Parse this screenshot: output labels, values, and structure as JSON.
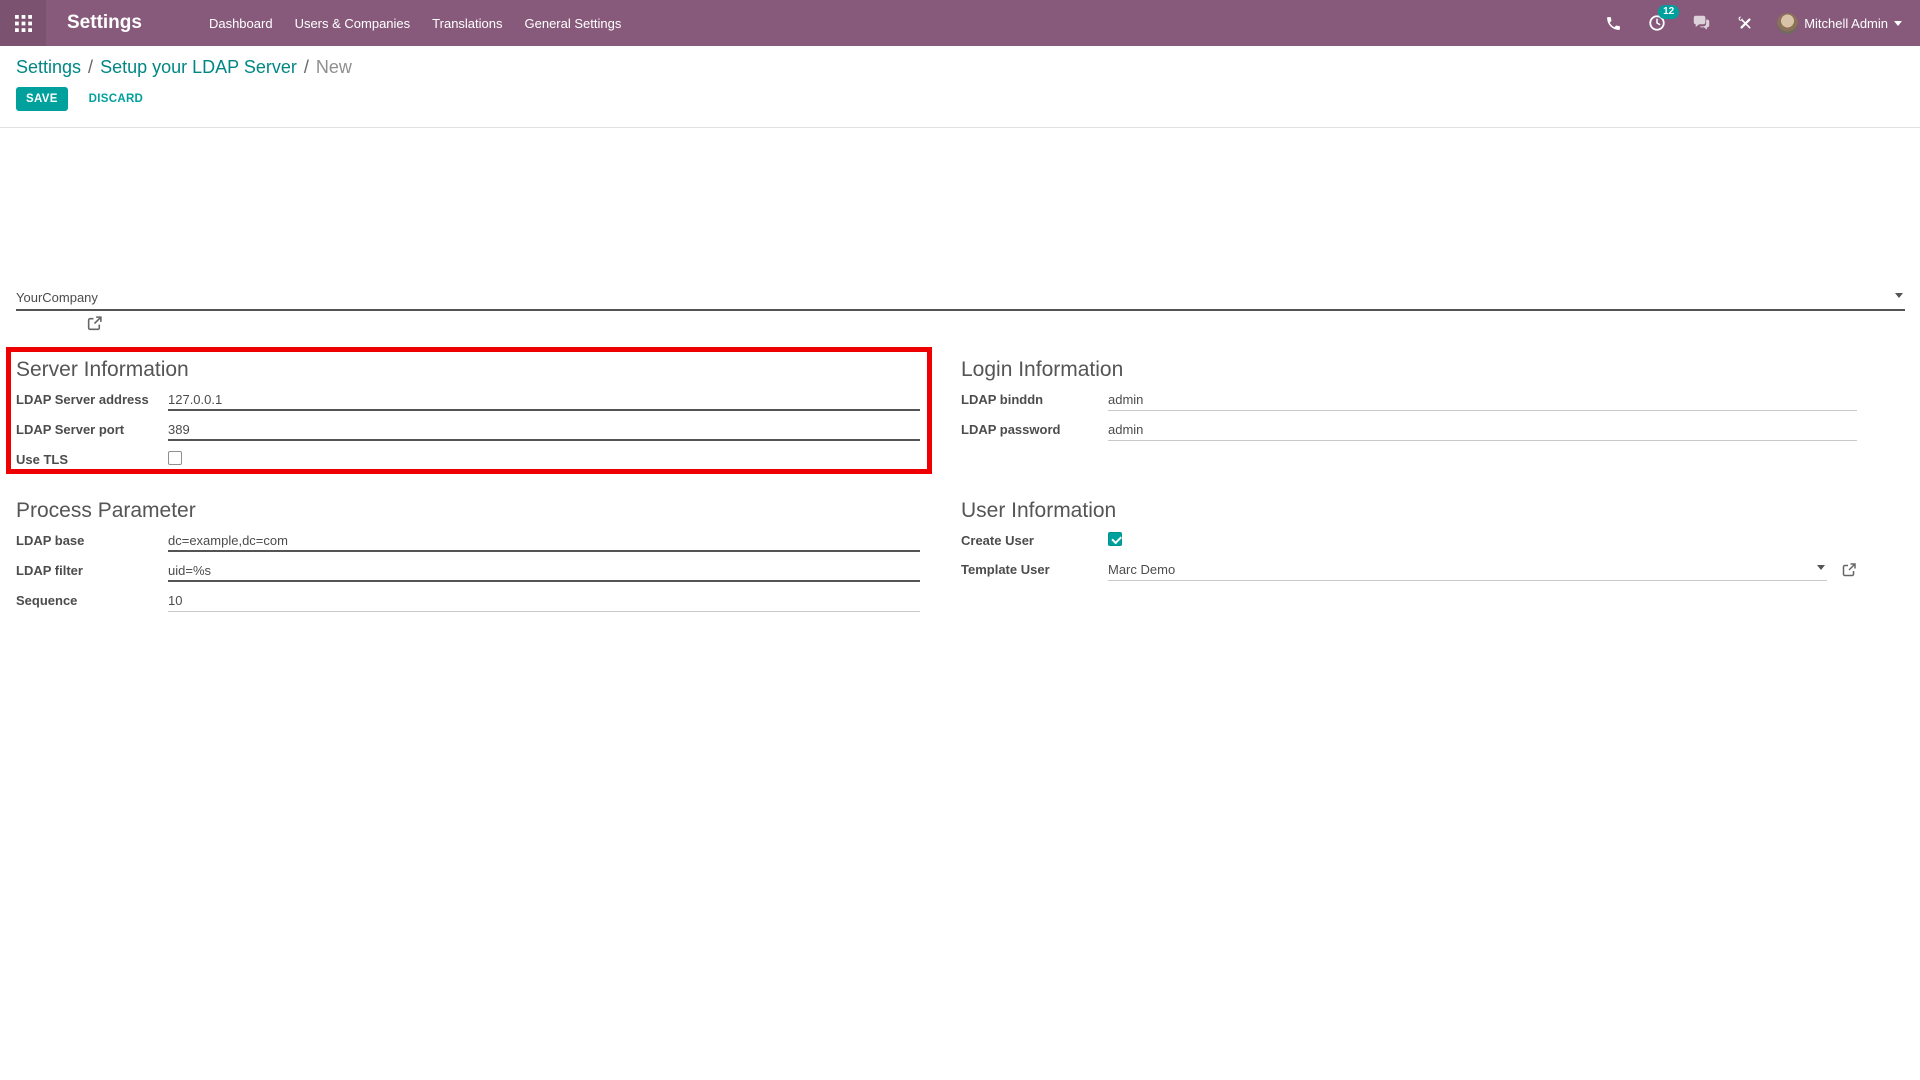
{
  "navbar": {
    "brand": "Settings",
    "menu_items": [
      "Dashboard",
      "Users & Companies",
      "Translations",
      "General Settings"
    ],
    "activity_count": "12",
    "user_name": "Mitchell Admin",
    "icons": [
      "apps-grid-icon",
      "phone-icon",
      "activity-clock-icon",
      "chat-bubbles-icon",
      "developer-tools-icon",
      "chevron-down-icon"
    ]
  },
  "breadcrumb": {
    "items": [
      "Settings",
      "Setup your LDAP Server",
      "New"
    ]
  },
  "toolbar": {
    "save_label": "SAVE",
    "discard_label": "DISCARD"
  },
  "form": {
    "company": {
      "value": "YourCompany"
    },
    "server": {
      "title": "Server Information",
      "address_label": "LDAP Server address",
      "address_value": "127.0.0.1",
      "port_label": "LDAP Server port",
      "port_value": "389",
      "tls_label": "Use TLS",
      "tls_checked": false
    },
    "login": {
      "title": "Login Information",
      "binddn_label": "LDAP binddn",
      "binddn_value": "admin",
      "password_label": "LDAP password",
      "password_value": "admin"
    },
    "process": {
      "title": "Process Parameter",
      "base_label": "LDAP base",
      "base_value": "dc=example,dc=com",
      "filter_label": "LDAP filter",
      "filter_value": "uid=%s",
      "sequence_label": "Sequence",
      "sequence_value": "10"
    },
    "user": {
      "title": "User Information",
      "create_label": "Create User",
      "create_checked": true,
      "template_label": "Template User",
      "template_value": "Marc Demo"
    }
  },
  "colors": {
    "navbar_bg": "#875A7B",
    "primary": "#00A09D",
    "link": "#008784",
    "text": "#4C4C4C",
    "muted": "#8F8F8F",
    "highlight_red": "#EF0000",
    "badge_bg": "#00A09D",
    "required_underline": "#545454",
    "underline": "#C9C9C9"
  }
}
